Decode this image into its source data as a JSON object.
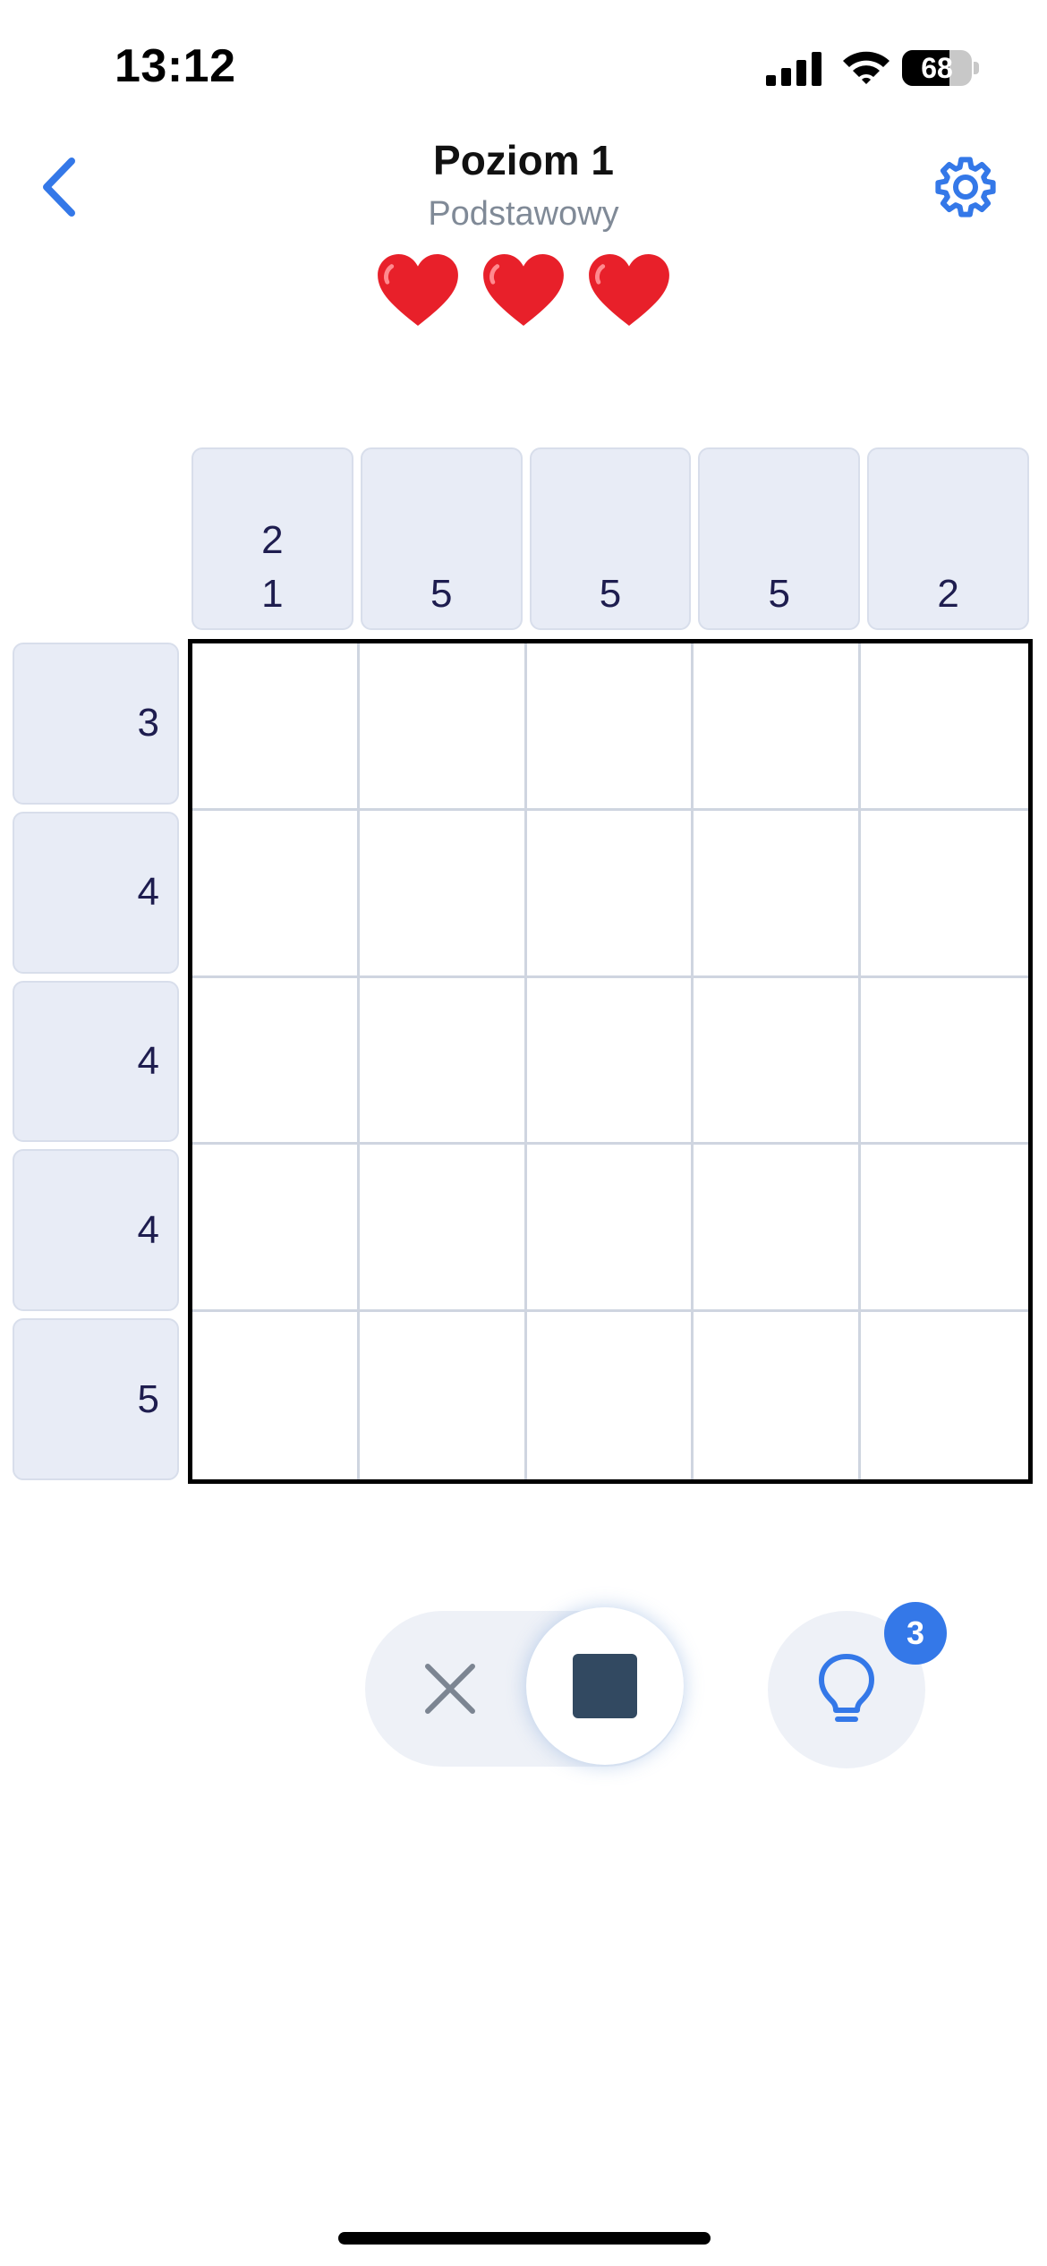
{
  "status_bar": {
    "time": "13:12",
    "battery_percent": "68",
    "battery_level": 0.68,
    "icons": [
      "signal-icon",
      "wifi-icon",
      "battery-icon"
    ]
  },
  "header": {
    "title": "Poziom 1",
    "subtitle": "Podstawowy",
    "back_icon": "chevron-left-icon",
    "settings_icon": "gear-icon",
    "lives": 3,
    "lives_icon": "heart-icon"
  },
  "puzzle": {
    "size": 5,
    "column_clues": [
      [
        "2",
        "1"
      ],
      [
        "5"
      ],
      [
        "5"
      ],
      [
        "5"
      ],
      [
        "2"
      ]
    ],
    "row_clues": [
      "3",
      "4",
      "4",
      "4",
      "5"
    ],
    "filled_cells": []
  },
  "controls": {
    "modes": [
      "cross",
      "fill"
    ],
    "selected_mode": "fill",
    "cross_icon": "cross-icon",
    "fill_icon": "filled-square-icon",
    "hint_icon": "lightbulb-icon",
    "hints_remaining": "3"
  },
  "colors": {
    "accent": "#3478e8",
    "clue_background": "#e8ecf6",
    "clue_text": "#1e1d4f",
    "fill": "#324961",
    "heart": "#e8202a",
    "grid_line": "#cfd5e0",
    "subtitle": "#808a97"
  }
}
